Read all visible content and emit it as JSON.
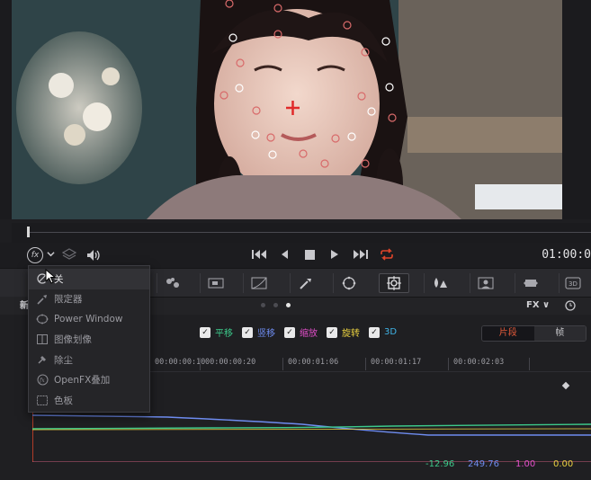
{
  "viewer": {
    "name": "video-preview"
  },
  "transport": {
    "fx_label": "fx",
    "timecode": "01:00:0"
  },
  "panel": {
    "left_label": "新",
    "fx_select": "FX ∨"
  },
  "keyframes": {
    "checkboxes": [
      {
        "label": "平移",
        "color": "#3cc98a"
      },
      {
        "label": "竖移",
        "color": "#6e8cf0"
      },
      {
        "label": "缩放",
        "color": "#e04ec8"
      },
      {
        "label": "旋转",
        "color": "#e8d040"
      },
      {
        "label": "3D",
        "color": "#3fb3e6"
      }
    ],
    "segment": {
      "active": "片段",
      "inactive": "帧"
    },
    "ruler_ticks": [
      "00:00:00:10",
      "00:00:00:20",
      "00:00:01:06",
      "00:00:01:17",
      "00:00:02:03"
    ],
    "readouts": [
      {
        "value": "-12.96",
        "color": "#3cc98a"
      },
      {
        "value": "249.76",
        "color": "#6e8cf0"
      },
      {
        "value": "1.00",
        "color": "#e04ec8"
      },
      {
        "value": "0.00",
        "color": "#e8d040"
      }
    ]
  },
  "menu": {
    "items": [
      {
        "label": "关",
        "icon": "circle-slash-icon"
      },
      {
        "label": "限定器",
        "icon": "eyedropper-icon"
      },
      {
        "label": "Power Window",
        "icon": "window-icon"
      },
      {
        "label": "图像划像",
        "icon": "image-wipe-icon"
      },
      {
        "label": "除尘",
        "icon": "dust-icon"
      },
      {
        "label": "OpenFX叠加",
        "icon": "fx-icon"
      },
      {
        "label": "色板",
        "icon": "swatch-icon"
      }
    ]
  }
}
